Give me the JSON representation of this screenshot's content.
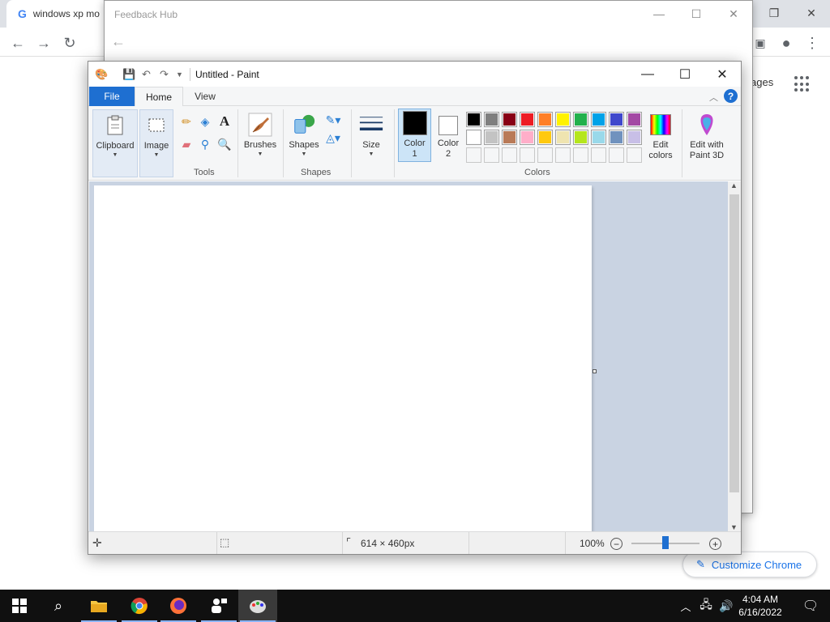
{
  "chrome": {
    "tab_title": "windows xp mo",
    "images_link": "ages",
    "customize_label": "Customize Chrome"
  },
  "feedback_hub": {
    "title": "Feedback Hub"
  },
  "paint": {
    "title": "Untitled - Paint",
    "tabs": {
      "file": "File",
      "home": "Home",
      "view": "View"
    },
    "ribbon": {
      "clipboard": "Clipboard",
      "image": "Image",
      "tools_label": "Tools",
      "brushes": "Brushes",
      "shapes": "Shapes",
      "shapes_label": "Shapes",
      "size": "Size",
      "color1": "Color\n1",
      "color1_line1": "Color",
      "color1_line2": "1",
      "color2_line1": "Color",
      "color2_line2": "2",
      "colors_label": "Colors",
      "edit_colors_line1": "Edit",
      "edit_colors_line2": "colors",
      "paint3d_line1": "Edit with",
      "paint3d_line2": "Paint 3D"
    },
    "palette_row1": [
      "#000000",
      "#7f7f7f",
      "#880015",
      "#ed1c24",
      "#ff7f27",
      "#fff200",
      "#22b14c",
      "#00a2e8",
      "#3f48cc",
      "#a349a4"
    ],
    "palette_row2": [
      "#ffffff",
      "#c3c3c3",
      "#b97a57",
      "#ffaec9",
      "#ffc90e",
      "#efe4b0",
      "#b5e61d",
      "#99d9ea",
      "#7092be",
      "#c8bfe7"
    ],
    "status": {
      "canvas_size": "614 × 460px",
      "zoom": "100%"
    }
  },
  "taskbar": {
    "time": "4:04 AM",
    "date": "6/16/2022"
  }
}
